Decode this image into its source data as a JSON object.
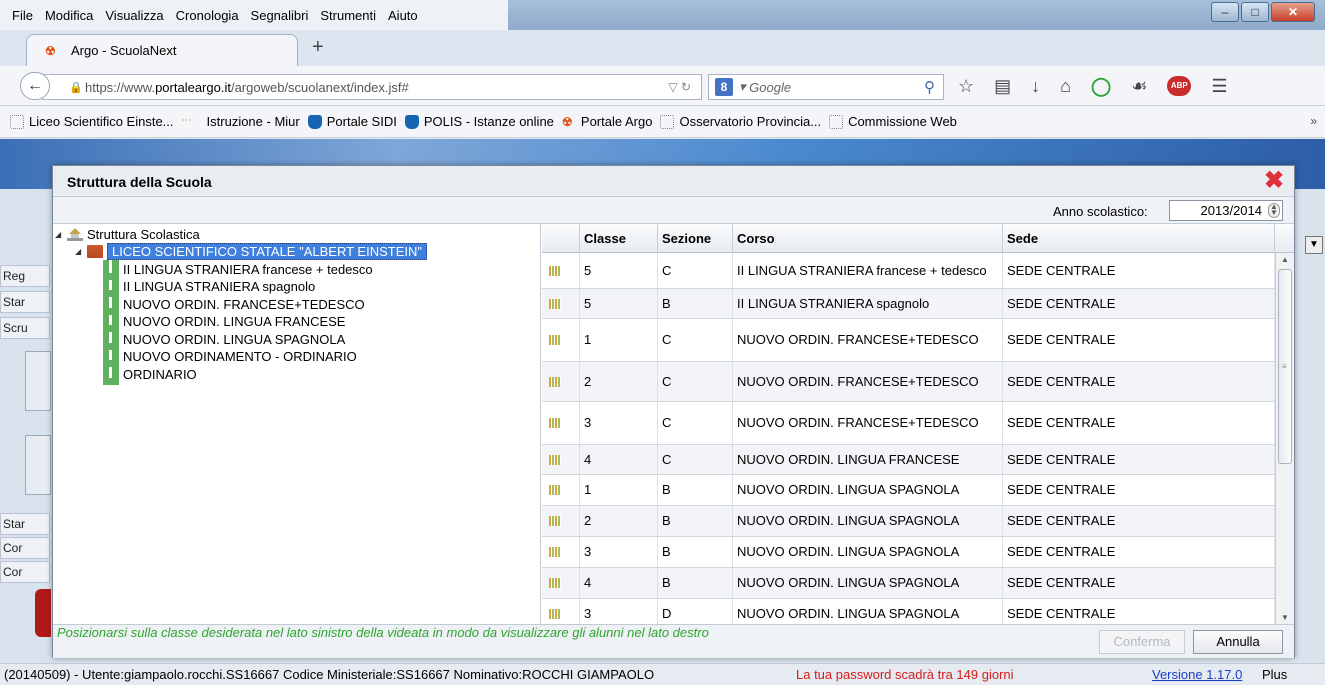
{
  "browser": {
    "menu": [
      "File",
      "Modifica",
      "Visualizza",
      "Cronologia",
      "Segnalibri",
      "Strumenti",
      "Aiuto"
    ],
    "tab_title": "Argo - ScuolaNext",
    "new_tab": "+",
    "url_prefix": "https://www.",
    "url_domain": "portaleargo.it",
    "url_path": "/argoweb/scuolanext/index.jsf#",
    "search_placeholder": "Google",
    "bookmarks": [
      "Liceo Scientifico Einste...",
      "Istruzione - Miur",
      "Portale SIDI",
      "POLIS - Istanze online",
      "Portale Argo",
      "Osservatorio Provincia...",
      "Commissione Web"
    ],
    "more": "»"
  },
  "page_behind": {
    "side_menu": [
      "Reg",
      "Star",
      "Scru",
      "Star",
      "Cor",
      "Cor"
    ]
  },
  "dialog": {
    "title": "Struttura della Scuola",
    "anno_label": "Anno scolastico:",
    "anno_value": "2013/2014",
    "tree": {
      "root": "Struttura Scolastica",
      "school": "LICEO SCIENTIFICO STATALE \"ALBERT EINSTEIN\"",
      "courses": [
        "II LINGUA STRANIERA francese + tedesco",
        "II LINGUA STRANIERA spagnolo",
        "NUOVO ORDIN. FRANCESE+TEDESCO",
        "NUOVO ORDIN. LINGUA FRANCESE",
        "NUOVO ORDIN. LINGUA SPAGNOLA",
        "NUOVO ORDINAMENTO - ORDINARIO",
        "ORDINARIO"
      ]
    },
    "table": {
      "headers": [
        "Classe",
        "Sezione",
        "Corso",
        "Sede"
      ],
      "rows": [
        [
          "5",
          "C",
          "II LINGUA STRANIERA francese + tedesco",
          "SEDE CENTRALE"
        ],
        [
          "5",
          "B",
          "II LINGUA STRANIERA spagnolo",
          "SEDE CENTRALE"
        ],
        [
          "1",
          "C",
          "NUOVO ORDIN. FRANCESE+TEDESCO",
          "SEDE CENTRALE"
        ],
        [
          "2",
          "C",
          "NUOVO ORDIN. FRANCESE+TEDESCO",
          "SEDE CENTRALE"
        ],
        [
          "3",
          "C",
          "NUOVO ORDIN. FRANCESE+TEDESCO",
          "SEDE CENTRALE"
        ],
        [
          "4",
          "C",
          "NUOVO ORDIN. LINGUA FRANCESE",
          "SEDE CENTRALE"
        ],
        [
          "1",
          "B",
          "NUOVO ORDIN. LINGUA SPAGNOLA",
          "SEDE CENTRALE"
        ],
        [
          "2",
          "B",
          "NUOVO ORDIN. LINGUA SPAGNOLA",
          "SEDE CENTRALE"
        ],
        [
          "3",
          "B",
          "NUOVO ORDIN. LINGUA SPAGNOLA",
          "SEDE CENTRALE"
        ],
        [
          "4",
          "B",
          "NUOVO ORDIN. LINGUA SPAGNOLA",
          "SEDE CENTRALE"
        ],
        [
          "3",
          "D",
          "NUOVO ORDIN. LINGUA SPAGNOLA",
          "SEDE CENTRALE"
        ]
      ]
    },
    "hint": "Posizionarsi sulla classe desiderata nel lato sinistro della videata in modo da visualizzare gli alunni nel lato destro",
    "confirm_label": "Conferma",
    "cancel_label": "Annulla"
  },
  "status": {
    "main": "(20140509) - Utente:giampaolo.rocchi.SS16667 Codice Ministeriale:SS16667 Nominativo:ROCCHI GIAMPAOLO",
    "password_warning": "La tua password scadrà tra 149 giorni",
    "version_link": "Versione 1.17.0",
    "version_suffix": "Plus"
  },
  "colors": {
    "selection": "#3f7fdd",
    "hint_green": "#2ea52e",
    "warning_red": "#d41c1c",
    "close_red": "#e0303a"
  }
}
